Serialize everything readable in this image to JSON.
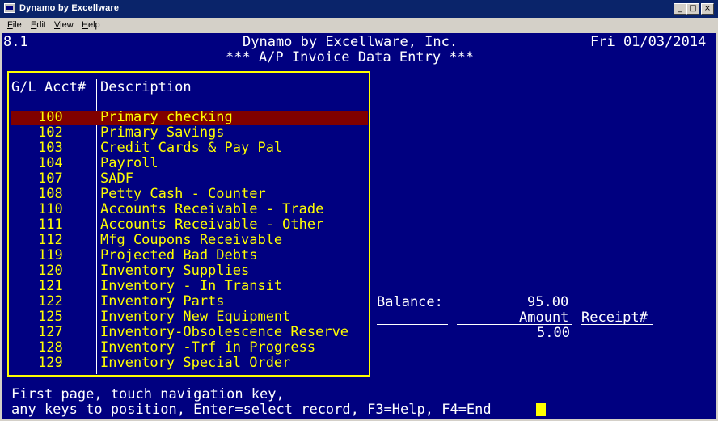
{
  "window": {
    "title": "Dynamo by Excellware",
    "min": "_",
    "max": "□",
    "close": "×"
  },
  "menu": [
    "File",
    "Edit",
    "View",
    "Help"
  ],
  "header": {
    "version": "8.1",
    "company": "Dynamo by Excellware, Inc.",
    "date": "Fri 01/03/2014",
    "subtitle": "*** A/P Invoice Data Entry ***"
  },
  "lookup": {
    "col_acct": "G/L Acct#",
    "col_desc": "Description",
    "rows": [
      {
        "acct": "100",
        "desc": "Primary checking"
      },
      {
        "acct": "102",
        "desc": "Primary Savings"
      },
      {
        "acct": "103",
        "desc": "Credit Cards & Pay Pal"
      },
      {
        "acct": "104",
        "desc": "Payroll"
      },
      {
        "acct": "107",
        "desc": "SADF"
      },
      {
        "acct": "108",
        "desc": "Petty Cash - Counter"
      },
      {
        "acct": "110",
        "desc": "Accounts Receivable - Trade"
      },
      {
        "acct": "111",
        "desc": "Accounts Receivable - Other"
      },
      {
        "acct": "112",
        "desc": "Mfg Coupons Receivable"
      },
      {
        "acct": "119",
        "desc": "Projected Bad Debts"
      },
      {
        "acct": "120",
        "desc": "Inventory Supplies"
      },
      {
        "acct": "121",
        "desc": "Inventory - In Transit"
      },
      {
        "acct": "122",
        "desc": "Inventory Parts"
      },
      {
        "acct": "125",
        "desc": "Inventory New Equipment"
      },
      {
        "acct": "127",
        "desc": "Inventory-Obsolescence Reserve"
      },
      {
        "acct": "128",
        "desc": "Inventory -Trf in Progress"
      },
      {
        "acct": "129",
        "desc": "Inventory Special Order"
      }
    ]
  },
  "right": {
    "balance_label": "Balance:",
    "balance_value": "95.00",
    "amount_label": "Amount",
    "receipt_label": "Receipt#",
    "amount_value": "5.00"
  },
  "footer": {
    "line1": "First page, touch navigation key,",
    "line2": "any keys to position, Enter=select record, F3=Help, F4=End"
  }
}
